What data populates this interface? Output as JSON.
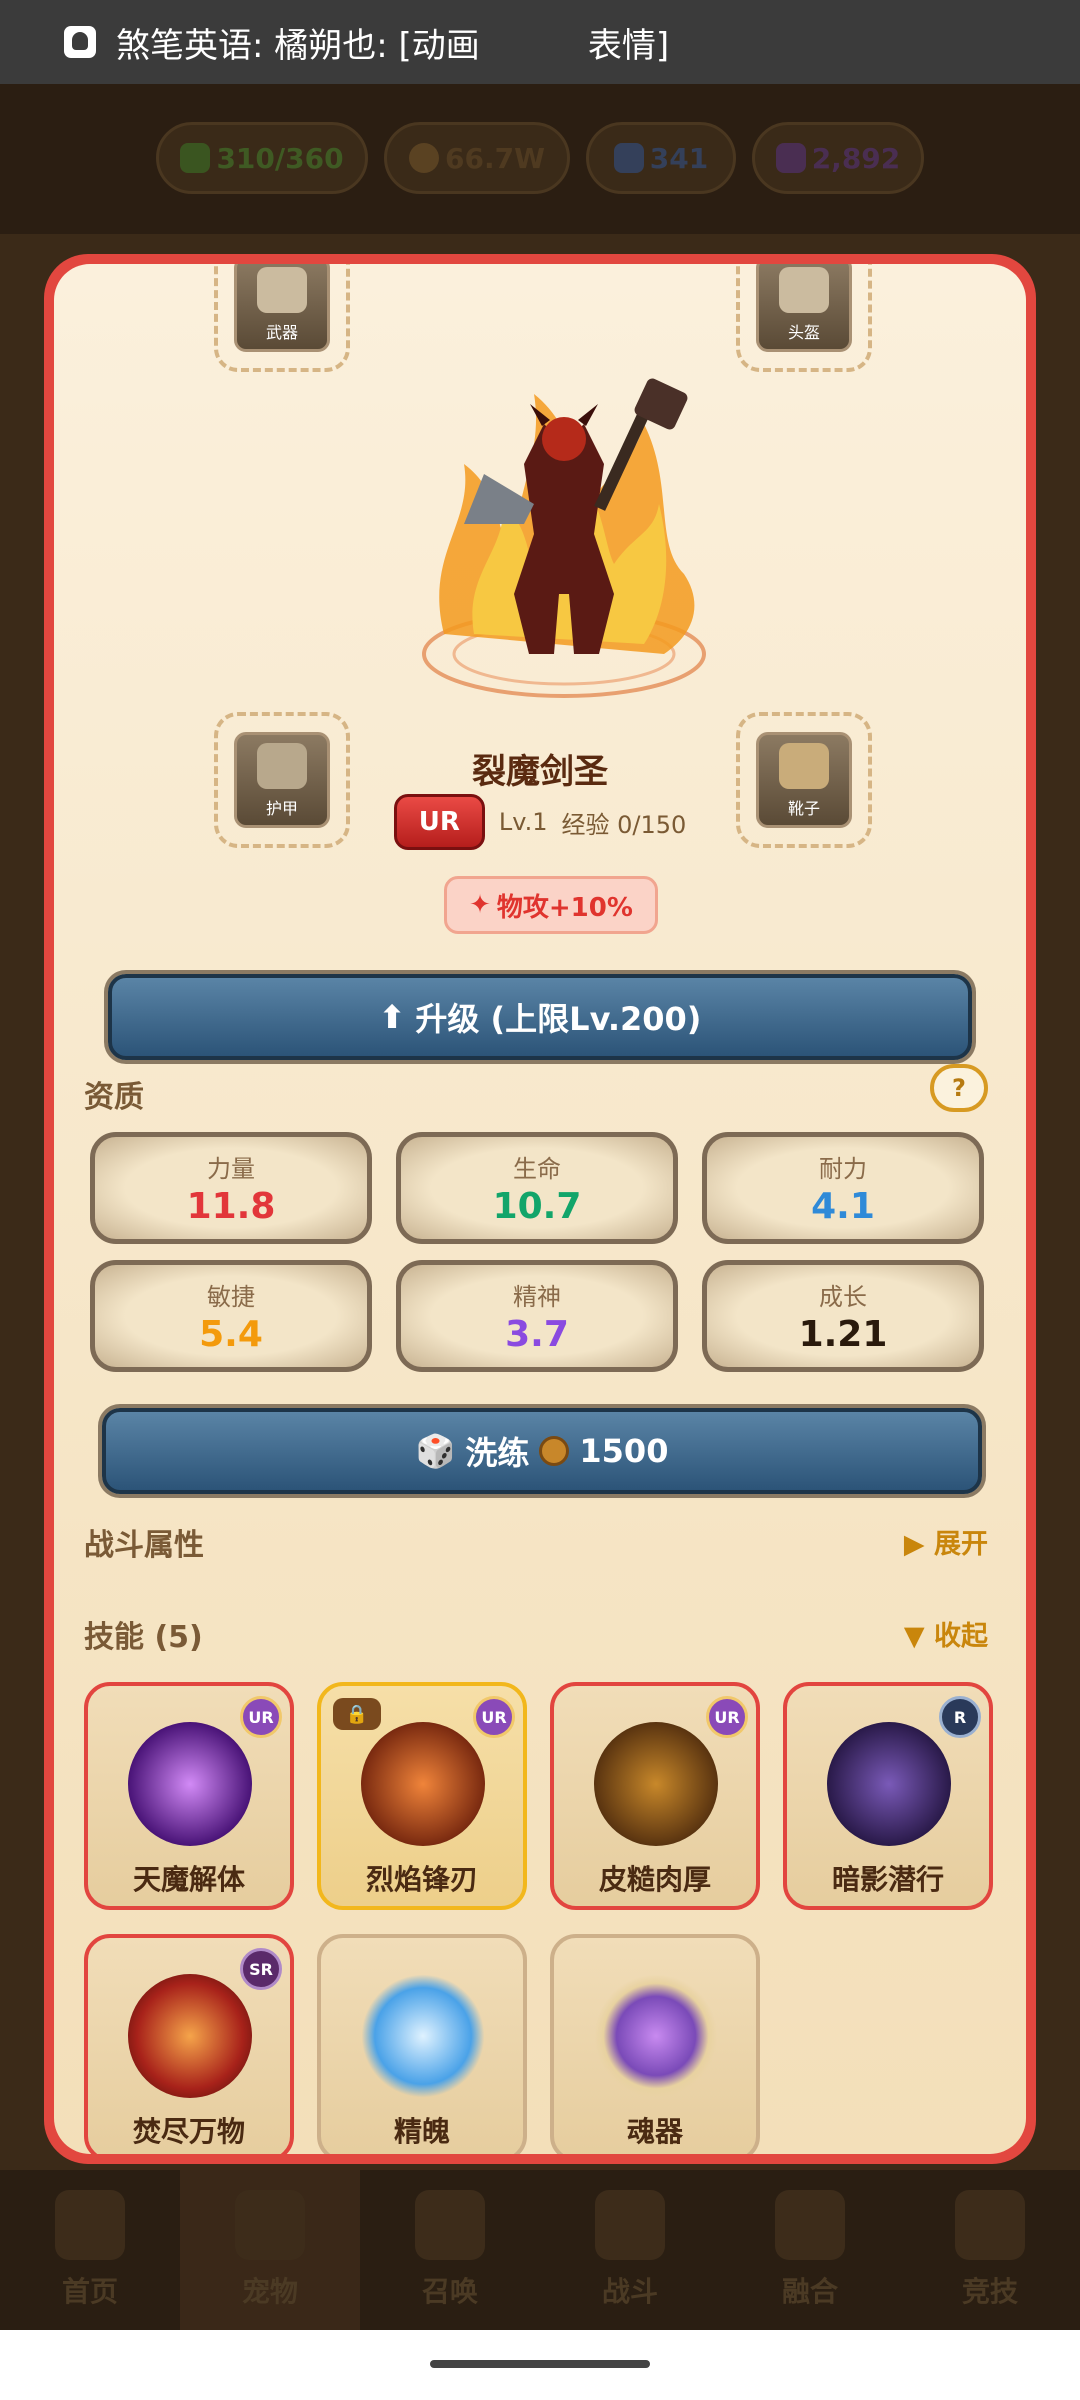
{
  "notification": {
    "text": "煞笔英语: 橘朔也: [动画          表情]"
  },
  "resources": [
    {
      "value": "310/360",
      "color": "#2e4a1a"
    },
    {
      "value": "66.7W",
      "color": "#5a3a1a"
    },
    {
      "value": "341",
      "color": "#2e3e5a"
    },
    {
      "value": "2,892",
      "color": "#4a2a5a"
    }
  ],
  "equipment": {
    "weapon": "武器",
    "helmet": "头盔",
    "armor": "护甲",
    "boots": "靴子"
  },
  "hero": {
    "name": "裂魔剑圣",
    "rarity": "UR",
    "level": "Lv.1",
    "exp": "经验 0/150",
    "buff": "物攻+10%"
  },
  "upgrade_button": "升级 (上限Lv.200)",
  "aptitude": {
    "title": "资质",
    "help": "?",
    "stats": [
      {
        "label": "力量",
        "value": "11.8",
        "color": "#e2363a"
      },
      {
        "label": "生命",
        "value": "10.7",
        "color": "#12a56a"
      },
      {
        "label": "耐力",
        "value": "4.1",
        "color": "#2f8ad8"
      },
      {
        "label": "敏捷",
        "value": "5.4",
        "color": "#f39a0c"
      },
      {
        "label": "精神",
        "value": "3.7",
        "color": "#8a4ae0"
      },
      {
        "label": "成长",
        "value": "1.21",
        "color": "#2a1a0c"
      }
    ]
  },
  "reroll_button": {
    "label": "洗练",
    "cost": "1500"
  },
  "battle_attr": {
    "title": "战斗属性",
    "toggle": "▶ 展开"
  },
  "skills": {
    "title": "技能 (5)",
    "toggle": "▼ 收起",
    "items": [
      {
        "name": "天魔解体",
        "rarity": "UR"
      },
      {
        "name": "烈焰锋刃",
        "rarity": "UR"
      },
      {
        "name": "皮糙肉厚",
        "rarity": "UR"
      },
      {
        "name": "暗影潜行",
        "rarity": "R"
      },
      {
        "name": "焚尽万物",
        "rarity": "SR"
      },
      {
        "name": "精魄",
        "rarity": ""
      },
      {
        "name": "魂器",
        "rarity": ""
      }
    ]
  },
  "nav": [
    {
      "label": "首页"
    },
    {
      "label": "宠物"
    },
    {
      "label": "召唤"
    },
    {
      "label": "战斗"
    },
    {
      "label": "融合"
    },
    {
      "label": "竞技"
    }
  ]
}
